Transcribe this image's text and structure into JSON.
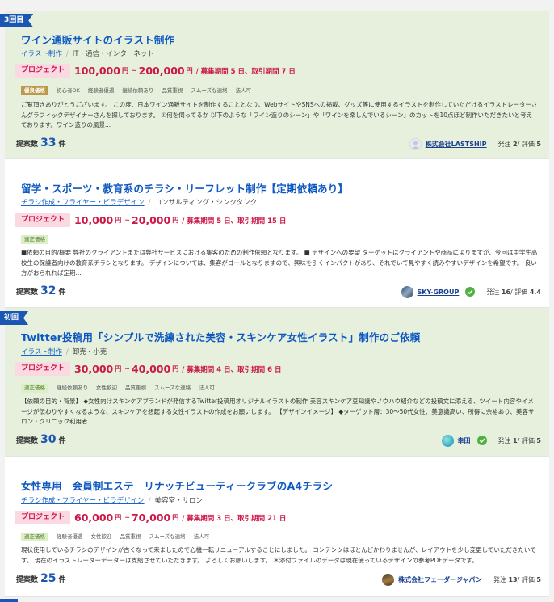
{
  "labels": {
    "project_tag": "プロジェクト",
    "yen": "円",
    "tilde": "~",
    "proposals_prefix": "提案数",
    "proposals_suffix": "件",
    "orders_prefix": "発注",
    "rating_prefix": "評価",
    "separator": "/"
  },
  "listings": [
    {
      "ribbon": "3回目",
      "title": "ワイン通販サイトのイラスト制作",
      "category": "イラスト制作",
      "industry": "IT・通信・インターネット",
      "price_min": "100,000",
      "price_max": "200,000",
      "period_info": "/ 募集期間 5 日、取引期間 7 日",
      "tags": [
        "優良価格",
        "初心者OK",
        "経験者優遇",
        "継続依頼あり",
        "品質重視",
        "スムーズな連絡",
        "法人可"
      ],
      "description": "ご覧頂きありがとうございます。 この度、日本ワイン通販サイトを制作することとなり、WebサイトやSNSへの掲載、グッズ等に使用するイラストを制作していただけるイラストレーターさんグラフィックデザイナーさんを探しております。 ①何を伺ってるか 以下のような「ワイン造りのシーン」や「ワインを楽しんでいるシーン」のカットを10点ほど制作いただきたいと考えております。ワイン造りの風景...",
      "proposals": "33",
      "client_name": "株式会社LASTSHIP",
      "orders": "2",
      "rating": "5"
    },
    {
      "ribbon": "",
      "title": "留学・スポーツ・教育系のチラシ・リーフレット制作【定期依頼あり】",
      "category": "チラシ作成・フライヤー・ビラデザイン",
      "industry": "コンサルティング・シンクタンク",
      "price_min": "10,000",
      "price_max": "20,000",
      "period_info": "/ 募集期間 5 日、取引期間 15 日",
      "tags": [
        "適正価格"
      ],
      "description": "■依頼の目的/概要 弊社のクライアントまたは弊社サービスにおける集客のための制作依頼となります。 ■ デザインへの要望 ターゲットはクライアントや商品によりますが、今回は中学生高校生の保護者向けの教育系チラシとなります。 デザインについては、集客がゴールとなりますので、興味を引くインパクトがあり、それでいて見やすく読みやすいデザインを希望です。 良い方がおられれば定期...",
      "proposals": "32",
      "client_name": "SKY-GROUP",
      "orders": "16",
      "rating": "4.4"
    },
    {
      "ribbon": "初回",
      "title": "Twitter投稿用「シンプルで洗練された美容・スキンケア女性イラスト」制作のご依頼",
      "category": "イラスト制作",
      "industry": "卸売・小売",
      "price_min": "30,000",
      "price_max": "40,000",
      "period_info": "/ 募集期間 4 日、取引期間 6 日",
      "tags": [
        "適正価格",
        "継続依頼あり",
        "女性歓迎",
        "品質重視",
        "スムーズな連絡",
        "法人可"
      ],
      "description": "【依頼の目的・背景】 ◆女性向けスキンケアブランドが発信するTwitter投稿用オリジナルイラストの制作 美容スキンケア豆知識やノウハウ紹介などの投稿文に添える、ツイート内容やイメージが伝わりやすくなるような、スキンケアを想起する女性イラストの作成をお願いします。 【デザインイメージ】 ◆ターゲット層：30〜50代女性、美意識高い、所得に余裕あり、美容サロン・クリニック利用者...",
      "proposals": "30",
      "client_name": "幸田",
      "orders": "1",
      "rating": "5"
    },
    {
      "ribbon": "",
      "title": "女性専用　会員制エステ　リナッチビューティークラブのA4チラシ",
      "category": "チラシ作成・フライヤー・ビラデザイン",
      "industry": "美容室・サロン",
      "price_min": "60,000",
      "price_max": "70,000",
      "period_info": "/ 募集期間 3 日、取引期間 21 日",
      "tags": [
        "適正価格",
        "経験者優遇",
        "女性歓迎",
        "品質重視",
        "スムーズな連絡",
        "法人可"
      ],
      "description": "現状使用しているチラシのデザインが古くなって来ましたので心機一転リニューアルすることにしました。 コンテンツはほとんどかわりませんが、レイアウトを少し変更していただきたいです。 現在のイラストレーターデーターは支給させていただきます。 よろしくお願いします。 ＊添付ファイルのデータは現在使っているデザインの参考PDFデータです。",
      "proposals": "25",
      "client_name": "株式会社フェーダージャパン",
      "orders": "13",
      "rating": "5"
    }
  ],
  "colors": {
    "highlight_bg": "#e6f0dd",
    "accent_blue": "#1b57b2",
    "price_red": "#cc1747",
    "verified_green": "#4fb240"
  }
}
